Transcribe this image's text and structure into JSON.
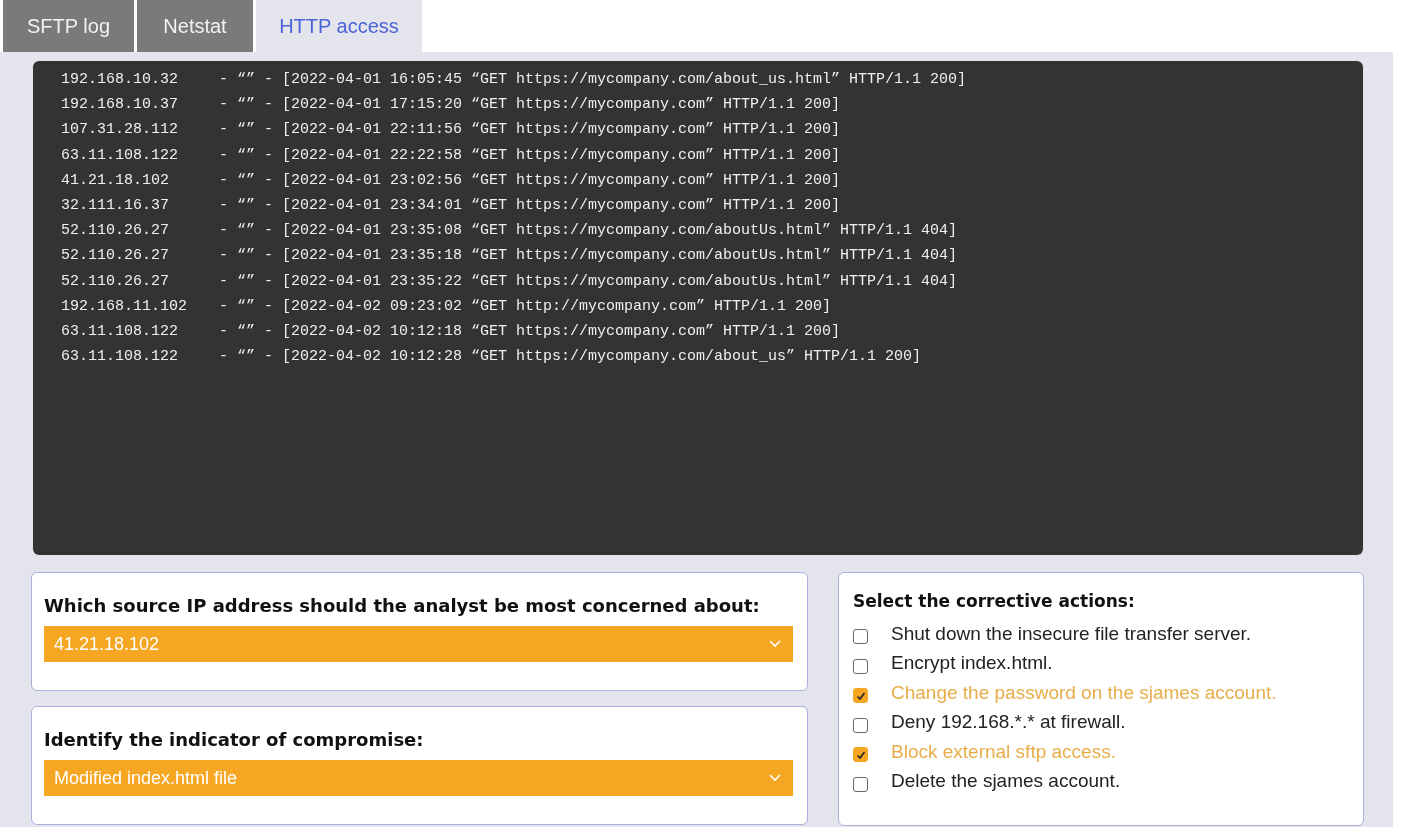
{
  "tabs": [
    {
      "label": "SFTP log",
      "selected": false
    },
    {
      "label": "Netstat",
      "selected": false
    },
    {
      "label": "HTTP access",
      "selected": true
    }
  ],
  "log": [
    {
      "ip": "192.168.10.32",
      "entry": "- “” - [2022-04-01 16:05:45 “GET https://mycompany.com/about_us.html” HTTP/1.1 200]"
    },
    {
      "ip": "192.168.10.37",
      "entry": "- “” - [2022-04-01 17:15:20 “GET https://mycompany.com” HTTP/1.1 200]"
    },
    {
      "ip": "107.31.28.112",
      "entry": "- “” - [2022-04-01 22:11:56 “GET https://mycompany.com” HTTP/1.1 200]"
    },
    {
      "ip": "63.11.108.122",
      "entry": "- “” - [2022-04-01 22:22:58 “GET https://mycompany.com” HTTP/1.1 200]"
    },
    {
      "ip": "41.21.18.102",
      "entry": "- “” - [2022-04-01 23:02:56 “GET https://mycompany.com” HTTP/1.1 200]"
    },
    {
      "ip": "32.111.16.37",
      "entry": "- “” - [2022-04-01 23:34:01 “GET https://mycompany.com” HTTP/1.1 200]"
    },
    {
      "ip": "52.110.26.27",
      "entry": "- “” - [2022-04-01 23:35:08 “GET https://mycompany.com/aboutUs.html” HTTP/1.1 404]"
    },
    {
      "ip": "52.110.26.27",
      "entry": "- “” - [2022-04-01 23:35:18 “GET https://mycompany.com/aboutUs.html” HTTP/1.1 404]"
    },
    {
      "ip": "52.110.26.27",
      "entry": "- “” - [2022-04-01 23:35:22 “GET https://mycompany.com/aboutUs.html” HTTP/1.1 404]"
    },
    {
      "ip": "192.168.11.102",
      "entry": "- “” - [2022-04-02 09:23:02 “GET http://mycompany.com” HTTP/1.1 200]"
    },
    {
      "ip": "63.11.108.122",
      "entry": "- “” - [2022-04-02 10:12:18 “GET https://mycompany.com” HTTP/1.1 200]"
    },
    {
      "ip": "63.11.108.122",
      "entry": "- “” - [2022-04-02 10:12:28 “GET https://mycompany.com/about_us” HTTP/1.1 200]"
    }
  ],
  "questions": [
    {
      "prompt": "Which source IP address should the analyst be most concerned about:",
      "value": "41.21.18.102"
    },
    {
      "prompt": "Identify the indicator of compromise:",
      "value": "Modified index.html file"
    }
  ],
  "actions": {
    "title": "Select the corrective actions:",
    "items": [
      {
        "label": "Shut down the insecure file transfer server.",
        "checked": false
      },
      {
        "label": "Encrypt index.html.",
        "checked": false
      },
      {
        "label": "Change the password on the sjames account.",
        "checked": true
      },
      {
        "label": "Deny 192.168.*.* at firewall.",
        "checked": false
      },
      {
        "label": "Block external sftp access.",
        "checked": true
      },
      {
        "label": "Delete the sjames account.",
        "checked": false
      }
    ]
  }
}
